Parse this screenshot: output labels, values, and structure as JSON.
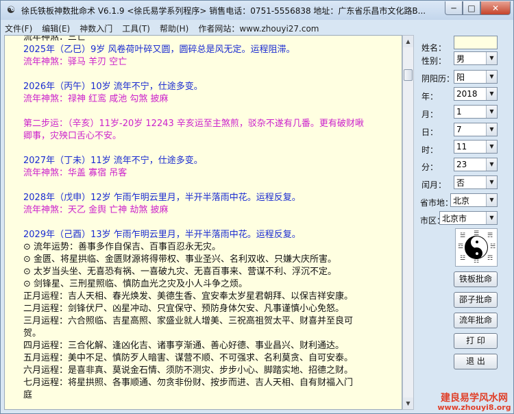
{
  "window": {
    "title": "徐氏铁板神数批命术 V6.1.9 <徐氏易学系列程序>    销售电话：0751-5556838    地址：广东省乐昌市文化路B...",
    "min_glyph": "─",
    "max_glyph": "□",
    "close_glyph": "✕"
  },
  "menu": [
    "文件(F)",
    "编辑(E)",
    "神数入门",
    "工具(T)",
    "帮助(H)",
    "作者网站：www.zhouyi27.com"
  ],
  "text_lines": [
    {
      "text": "流年神煞：三亡",
      "color": "black"
    },
    {
      "text": "2025年（乙巳）9岁  风卷荷叶碎又圆，圆碎总是风无定。运程阻滞。",
      "color": "blue"
    },
    {
      "text": "流年神煞：驿马    羊刃    空亡",
      "color": "pink"
    },
    {
      "text": "",
      "color": "black"
    },
    {
      "text": "2026年（丙午）10岁  流年不宁，仕途多变。",
      "color": "blue"
    },
    {
      "text": "流年神煞：禄神    红鸾    咸池    勾煞    披麻",
      "color": "pink"
    },
    {
      "text": "",
      "color": "black"
    },
    {
      "text": "第二步运：（辛亥）11岁-20岁  12243   辛亥运至主煞煎，驳杂不遂有几番。更有破财啾",
      "color": "pink"
    },
    {
      "text": "卿事，灾殃口舌心不安。",
      "color": "pink"
    },
    {
      "text": "",
      "color": "black"
    },
    {
      "text": "2027年（丁未）11岁  流年不宁，仕途多变。",
      "color": "blue"
    },
    {
      "text": "流年神煞：华盖    寡宿    吊客",
      "color": "pink"
    },
    {
      "text": "",
      "color": "black"
    },
    {
      "text": "2028年（戊申）12岁  乍雨乍明云里月，半开半落雨中花。运程反复。",
      "color": "blue"
    },
    {
      "text": "流年神煞：天乙    金舆    亡神    劫煞    披麻",
      "color": "pink"
    },
    {
      "text": "",
      "color": "black"
    },
    {
      "text": "2029年（己酉）13岁  乍雨乍明云里月，半开半落雨中花。运程反复。",
      "color": "blue"
    },
    {
      "text": "⊙ 流年运势：善事多作自保吉、百事百忍永无灾。",
      "color": "black"
    },
    {
      "text": "⊙ 金匮、将星拱临、金匮财源将得带权、事业圣兴、名利双收、只嫌大庆所害。",
      "color": "black"
    },
    {
      "text": "⊙ 太岁当头坐、无喜恐有祸、一喜破九灾、无喜百事来、营谋不利、浮沉不定。",
      "color": "black"
    },
    {
      "text": "⊙ 剑锋星、三刑星照临、慎防血光之灾及小人斗争之烦。",
      "color": "black"
    },
    {
      "text": "正月运程：吉人天相、春光焕发、美德生香、宜安奉太岁星君朝拜、以保吉祥安康。",
      "color": "black"
    },
    {
      "text": "二月运程：剑锋伏尸、凶星冲动、只宜保守、预防身体欠安、凡事谨慎小心免怒。",
      "color": "black"
    },
    {
      "text": "三月运程：六合照临、吉星高照、家盛业就人增美、三祝高祖贺太平、财喜并至良可",
      "color": "black"
    },
    {
      "text": "贺。",
      "color": "black"
    },
    {
      "text": "四月运程：三合化解、逢凶化吉、诸事亨渐通、善心好德、事业昌兴、财利通达。",
      "color": "black"
    },
    {
      "text": "五月运程：美中不足、慎防歹人暗害、谋营不顺、不可强求、名利莫贪、自可安泰。",
      "color": "black"
    },
    {
      "text": "六月运程：是喜非真、莫说金石情、须防不测灾、步步小心、脚踏实地、招德之财。",
      "color": "black"
    },
    {
      "text": "七月运程：将星拱照、各事顺通、勿贪非份财、按步而进、吉人天相、自有财福入门",
      "color": "black"
    },
    {
      "text": "庭",
      "color": "black"
    }
  ],
  "form": {
    "name_label": "姓名：",
    "name_value": "",
    "gender_label": "性别：",
    "gender_value": "男",
    "calendar_label": "阴阳历：",
    "calendar_value": "阳",
    "year_label": "年：",
    "year_value": "2018",
    "month_label": "月：",
    "month_value": "1",
    "day_label": "日：",
    "day_value": "7",
    "hour_label": "时：",
    "hour_value": "11",
    "minute_label": "分：",
    "minute_value": "23",
    "leap_label": "闰月：",
    "leap_value": "否",
    "province_label": "省市地：",
    "province_value": "北京",
    "district_label": "市区：",
    "district_value": "北京市"
  },
  "buttons": {
    "tieban": "铁板批命",
    "shaozi": "邵子批命",
    "liunian": "流年批命",
    "print": "打 印",
    "exit": "退 出"
  },
  "watermark": {
    "line1": "建良易学风水网",
    "line2": "www.zhouyi8.org"
  },
  "icons": {
    "dropdown": "▼",
    "scroll_up": "▲",
    "scroll_down": "▼",
    "app": "☯"
  }
}
